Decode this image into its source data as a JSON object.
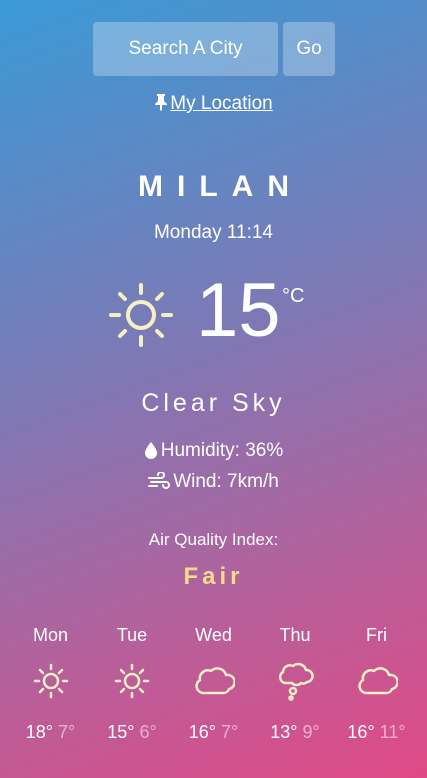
{
  "search": {
    "placeholder": "Search A City",
    "go_label": "Go"
  },
  "location": {
    "label": "My Location"
  },
  "current": {
    "city": "MILAN",
    "datetime": "Monday 11:14",
    "temp": "15",
    "unit": "°C",
    "icon": "sun-icon",
    "description": "Clear Sky",
    "humidity": "Humidity: 36%",
    "wind": "Wind: 7km/h"
  },
  "air_quality": {
    "label": "Air Quality Index:",
    "value": "Fair",
    "color": "#f2dc8a"
  },
  "forecast": [
    {
      "day": "Mon",
      "icon": "sun-icon",
      "high": "18°",
      "low": "7°"
    },
    {
      "day": "Tue",
      "icon": "sun-icon",
      "high": "15°",
      "low": "6°"
    },
    {
      "day": "Wed",
      "icon": "cloud-icon",
      "high": "16°",
      "low": "7°"
    },
    {
      "day": "Thu",
      "icon": "thought-cloud-icon",
      "high": "13°",
      "low": "9°"
    },
    {
      "day": "Fri",
      "icon": "cloud-icon",
      "high": "16°",
      "low": "11°"
    }
  ],
  "colors": {
    "icon": "#f6efc4",
    "gradient_start": "#3a9ad6",
    "gradient_end": "#e04a86"
  }
}
